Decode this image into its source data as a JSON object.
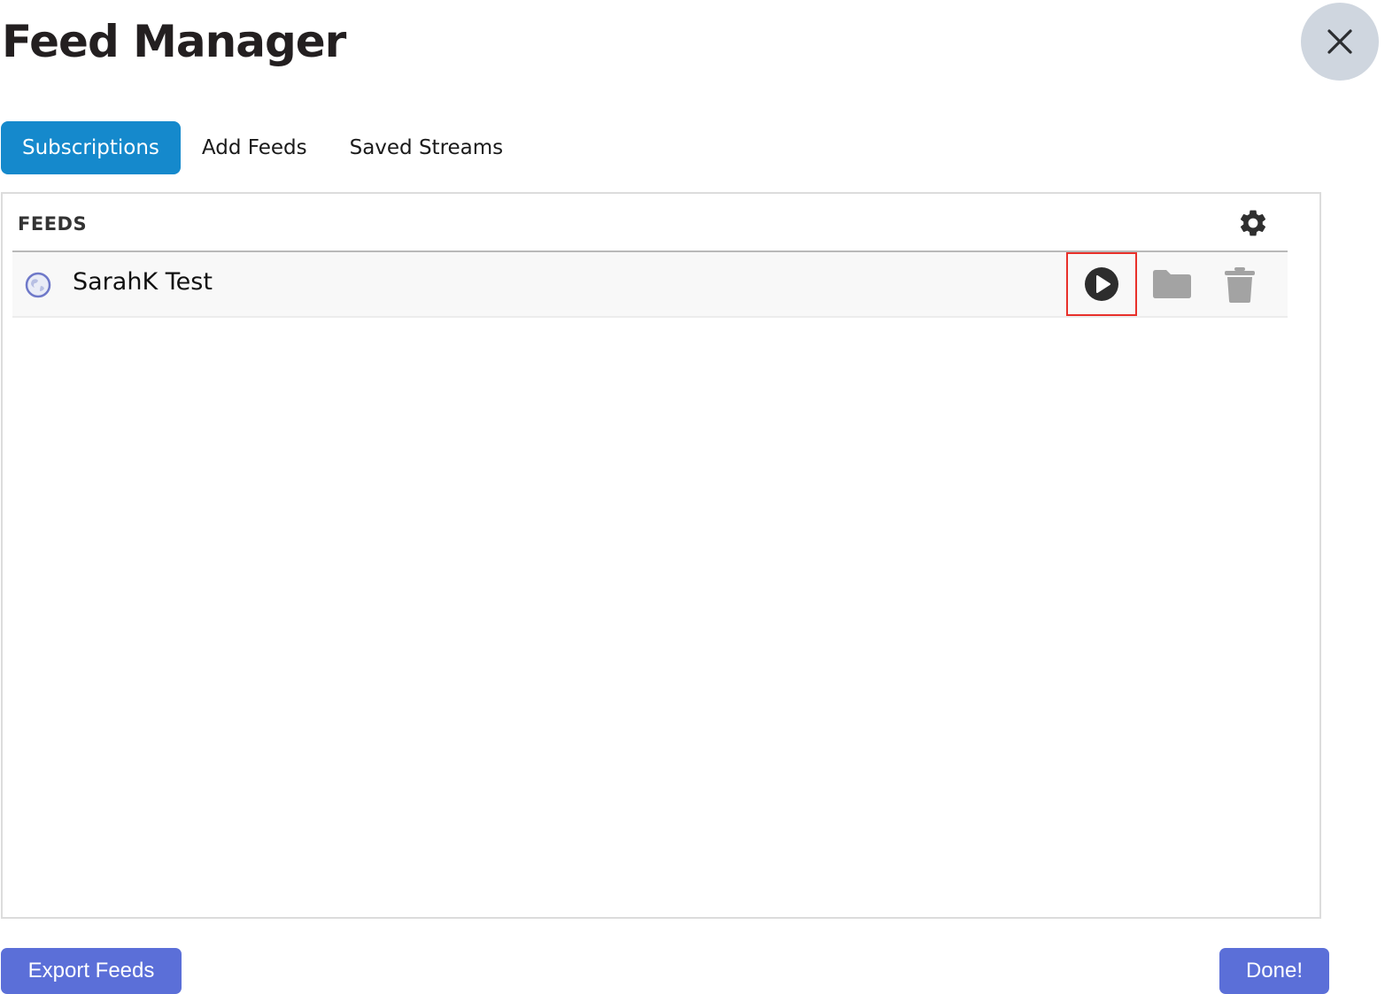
{
  "header": {
    "title": "Feed Manager",
    "close_icon": "close-icon"
  },
  "tabs": [
    {
      "label": "Subscriptions",
      "active": true
    },
    {
      "label": "Add Feeds",
      "active": false
    },
    {
      "label": "Saved Streams",
      "active": false
    }
  ],
  "panel": {
    "heading": "FEEDS",
    "settings_icon": "gear-icon",
    "feeds": [
      {
        "name": "SarahK Test",
        "icon": "globe-icon",
        "actions": [
          "play-icon",
          "folder-icon",
          "trash-icon"
        ],
        "highlighted_action": "play-icon"
      }
    ]
  },
  "footer": {
    "export_label": "Export Feeds",
    "done_label": "Done!"
  },
  "colors": {
    "tab_active": "#1589cc",
    "button": "#5b6fd8",
    "highlight_box": "#e8302a",
    "close_bg": "#cfd6df"
  }
}
